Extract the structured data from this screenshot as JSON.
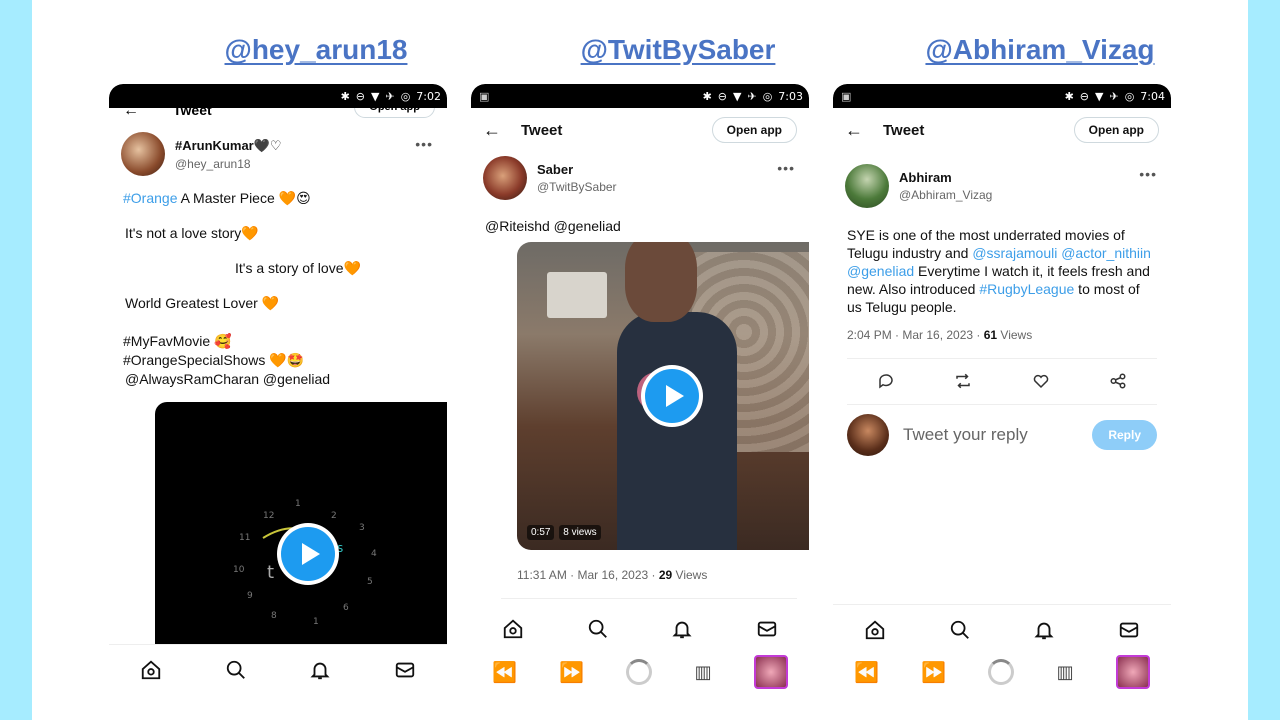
{
  "handles": [
    "@hey_arun18",
    "@TwitBySaber",
    "@Abhiram_Vizag"
  ],
  "phones": [
    {
      "status_time": "7:02",
      "topbar": {
        "title": "Tweet",
        "open_app": "Open app"
      },
      "user": {
        "name": "#ArunKumar🖤♡",
        "handle": "@hey_arun18"
      },
      "lines": [
        {
          "link": "#Orange",
          "text": " A Master Piece 🧡😍"
        },
        {
          "text": "It's not a love story🧡"
        },
        {
          "text": "It's a story of love🧡"
        },
        {
          "text": "World Greatest Lover 🧡"
        }
      ],
      "tags": [
        "#MyFavMovie 🥰",
        "#OrangeSpecialShows 🧡🤩",
        "@AlwaysRamCharan  @geneliad"
      ],
      "video_icon": "play-icon",
      "nav": [
        "home-icon",
        "search-icon",
        "bell-icon",
        "mail-icon"
      ]
    },
    {
      "status_time": "7:03",
      "topbar": {
        "title": "Tweet",
        "open_app": "Open app"
      },
      "user": {
        "name": "Saber",
        "handle": "@TwitBySaber"
      },
      "mentions": "@Riteishd @geneliad",
      "video": {
        "duration": "0:57",
        "views": "8 views"
      },
      "meta": {
        "time": "11:31 AM · Mar 16, 2023 · ",
        "count": "29",
        "label": " Views"
      },
      "nav": [
        "home-icon",
        "search-icon",
        "bell-icon",
        "mail-icon"
      ]
    },
    {
      "status_time": "7:04",
      "topbar": {
        "title": "Tweet",
        "open_app": "Open app"
      },
      "user": {
        "name": "Abhiram",
        "handle": "@Abhiram_Vizag"
      },
      "body": {
        "t1": "SYE is one of the most underrated movies of Telugu industry and ",
        "l1": "@ssrajamouli",
        "l2": "@actor_nithiin",
        "l3": "@geneliad",
        "t2": " Everytime I watch it, it feels fresh and new. Also introduced ",
        "l4": "#RugbyLeague",
        "t3": " to most of us Telugu people."
      },
      "meta": {
        "time": "2:04 PM · Mar 16, 2023 · ",
        "count": "61",
        "label": " Views"
      },
      "actions": [
        "reply-icon",
        "retweet-icon",
        "like-icon",
        "share-icon"
      ],
      "reply": {
        "placeholder": "Tweet your reply",
        "button": "Reply"
      },
      "nav": [
        "home-icon",
        "search-icon",
        "bell-icon",
        "mail-icon"
      ]
    }
  ],
  "colors": {
    "accent": "#1d9bf0",
    "link": "#3d9ee8",
    "handle": "#4a74c4",
    "background": "#a6ecff"
  }
}
